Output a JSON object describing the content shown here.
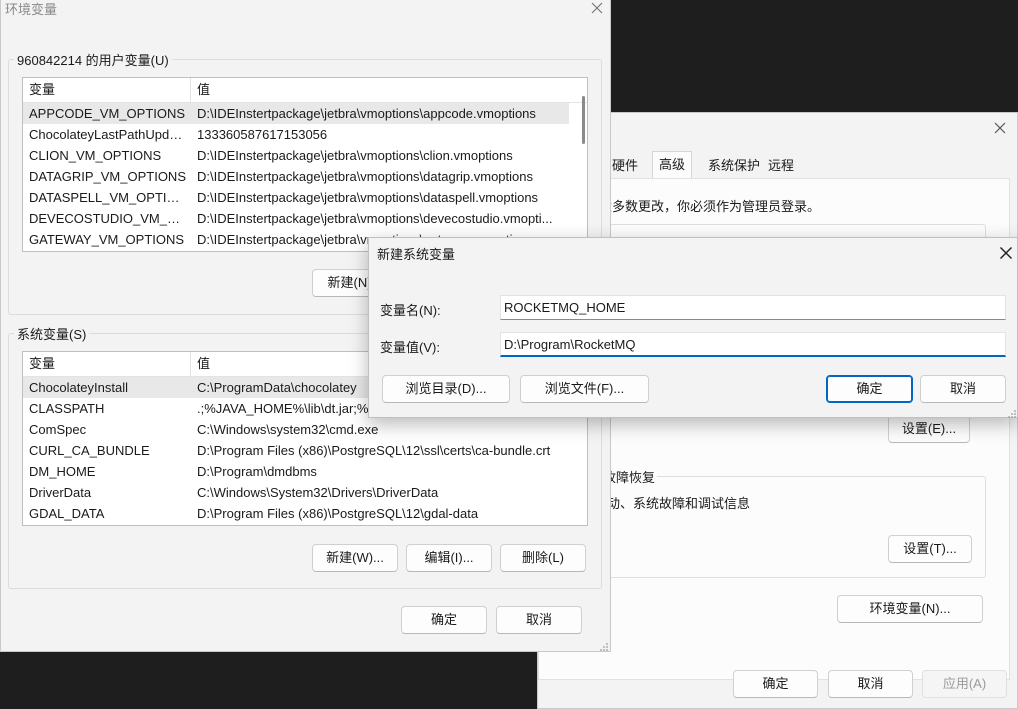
{
  "system_properties": {
    "tabs": [
      {
        "label": "硬件",
        "active": false
      },
      {
        "label": "高级",
        "active": true
      },
      {
        "label": "系统保护",
        "active": false
      },
      {
        "label": "远程",
        "active": false
      }
    ],
    "admin_note": "大多数更改，你必须作为管理员登录。",
    "settings_e_label": "设置(E)...",
    "startup_group_title": "故障恢复",
    "startup_desc": "动、系统故障和调试信息",
    "settings_t_label": "设置(T)...",
    "env_vars_label": "环境变量(N)...",
    "ok_label": "确定",
    "cancel_label": "取消",
    "apply_label": "应用(A)"
  },
  "env_window": {
    "title": "环境变量",
    "user_section_title": "960842214 的用户变量(U)",
    "column_var": "变量",
    "column_value": "值",
    "user_vars": [
      {
        "name": "APPCODE_VM_OPTIONS",
        "value": "D:\\IDEInstertpackage\\jetbra\\vmoptions\\appcode.vmoptions"
      },
      {
        "name": "ChocolateyLastPathUpdate",
        "value": "133360587617153056"
      },
      {
        "name": "CLION_VM_OPTIONS",
        "value": "D:\\IDEInstertpackage\\jetbra\\vmoptions\\clion.vmoptions"
      },
      {
        "name": "DATAGRIP_VM_OPTIONS",
        "value": "D:\\IDEInstertpackage\\jetbra\\vmoptions\\datagrip.vmoptions"
      },
      {
        "name": "DATASPELL_VM_OPTIONS",
        "value": "D:\\IDEInstertpackage\\jetbra\\vmoptions\\dataspell.vmoptions"
      },
      {
        "name": "DEVECOSTUDIO_VM_OPT...",
        "value": "D:\\IDEInstertpackage\\jetbra\\vmoptions\\devecostudio.vmopti..."
      },
      {
        "name": "GATEWAY_VM_OPTIONS",
        "value": "D:\\IDEInstertpackage\\jetbra\\vmoptions\\gateway.vmoptions"
      }
    ],
    "user_new_label": "新建(N)...",
    "system_section_title": "系统变量(S)",
    "system_vars": [
      {
        "name": "ChocolateyInstall",
        "value": "C:\\ProgramData\\chocolatey"
      },
      {
        "name": "CLASSPATH",
        "value": ".;%JAVA_HOME%\\lib\\dt.jar;%JAVA_HOME%\\lib\\tools.jar"
      },
      {
        "name": "ComSpec",
        "value": "C:\\Windows\\system32\\cmd.exe"
      },
      {
        "name": "CURL_CA_BUNDLE",
        "value": "D:\\Program Files (x86)\\PostgreSQL\\12\\ssl\\certs\\ca-bundle.crt"
      },
      {
        "name": "DM_HOME",
        "value": "D:\\Program\\dmdbms"
      },
      {
        "name": "DriverData",
        "value": "C:\\Windows\\System32\\Drivers\\DriverData"
      },
      {
        "name": "GDAL_DATA",
        "value": "D:\\Program Files (x86)\\PostgreSQL\\12\\gdal-data"
      }
    ],
    "sys_new_label": "新建(W)...",
    "sys_edit_label": "编辑(I)...",
    "sys_delete_label": "删除(L)",
    "ok_label": "确定",
    "cancel_label": "取消"
  },
  "new_var_dialog": {
    "title": "新建系统变量",
    "name_label": "变量名(N):",
    "value_label": "变量值(V):",
    "name_value": "ROCKETMQ_HOME",
    "value_value": "D:\\Program\\RocketMQ",
    "browse_dir_label": "浏览目录(D)...",
    "browse_file_label": "浏览文件(F)...",
    "ok_label": "确定",
    "cancel_label": "取消"
  },
  "colors": {
    "accent": "#0067c0",
    "window_bg": "#f3f3f3",
    "desktop": "#1e1e1e"
  },
  "icons": [
    "close-icon",
    "resize-grip-icon"
  ]
}
